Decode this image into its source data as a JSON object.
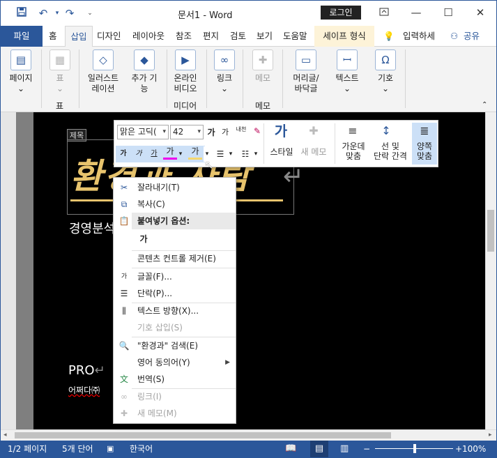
{
  "titlebar": {
    "document_title": "문서1  -  Word",
    "login_label": "로그인"
  },
  "tabs": [
    {
      "label": "파일"
    },
    {
      "label": "홈"
    },
    {
      "label": "삽입"
    },
    {
      "label": "디자인"
    },
    {
      "label": "레이아웃"
    },
    {
      "label": "참조"
    },
    {
      "label": "편지"
    },
    {
      "label": "검토"
    },
    {
      "label": "보기"
    },
    {
      "label": "도움말"
    },
    {
      "label": "세이프 형식"
    }
  ],
  "tell_me": "입력하세",
  "share_label": "공유",
  "ribbon": {
    "page": "페이지",
    "table": "표",
    "table_group": "표",
    "illustrations_1": "일러스트",
    "illustrations_2": "레이션",
    "addins_1": "추가 기",
    "addins_2": "능",
    "online_video_1": "온라인",
    "online_video_2": "비디오",
    "media_group": "미디어",
    "link": "링크",
    "comment": "메모",
    "comment_group": "메모",
    "header_footer_1": "머리글/",
    "header_footer_2": "바닥글",
    "text": "텍스트",
    "symbol": "기호"
  },
  "document": {
    "title_tag": "제목",
    "big_title": "환경과 사람",
    "subline": "경영분석",
    "pro": "PRO",
    "note": "어쩌다㈜"
  },
  "mini_toolbar": {
    "font_name": "맑은 고딕(",
    "font_size": "42",
    "grow": "가",
    "shrink": "가",
    "phonetic": "내천",
    "bold": "가",
    "italic": "가",
    "underline": "가",
    "highlight": "가",
    "shading": "가",
    "style": "스타일",
    "new_comment": "새 메모",
    "center_1": "가운데",
    "center_2": "맞춤",
    "spacing_1": "선 및",
    "spacing_2": "단락 간격",
    "justify_1": "양쪽",
    "justify_2": "맞춤"
  },
  "context_menu": {
    "cut": "잘라내기(T)",
    "copy": "복사(C)",
    "paste_options": "붙여넣기 옵션:",
    "paste_icon_text": "가",
    "remove_content_control": "콘텐츠 컨트롤 제거(E)",
    "font": "글꼴(F)...",
    "paragraph": "단락(P)...",
    "text_direction": "텍스트 방향(X)...",
    "insert_symbol": "기호 삽입(S)",
    "search": "\"환경과\" 검색(E)",
    "synonyms": "영어 동의어(Y)",
    "translate": "번역(S)",
    "link": "링크(I)",
    "new_comment": "새 메모(M)"
  },
  "status": {
    "page": "1/2 페이지",
    "words": "5개 단어",
    "language": "한국어",
    "zoom": "100%"
  },
  "colors": {
    "accent": "#2b579a",
    "title_gold": "#e8c46d"
  }
}
